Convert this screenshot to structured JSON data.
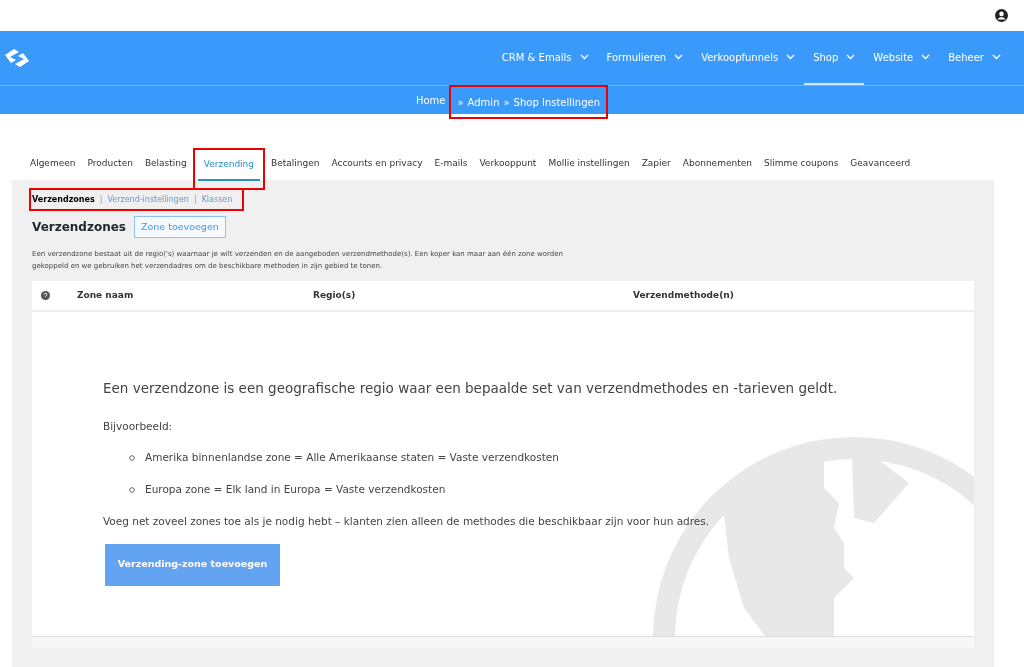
{
  "nav": {
    "items": [
      {
        "label": "CRM & Emails",
        "selected": false
      },
      {
        "label": "Formulieren",
        "selected": false
      },
      {
        "label": "Verkoopfunnels",
        "selected": false
      },
      {
        "label": "Shop",
        "selected": true
      },
      {
        "label": "Website",
        "selected": false
      },
      {
        "label": "Beheer",
        "selected": false
      }
    ]
  },
  "breadcrumb": [
    "Home",
    "Admin",
    "Shop Instellingen"
  ],
  "breadcrumb_separator": "»",
  "tabs": [
    {
      "label": "Algemeen",
      "selected": false
    },
    {
      "label": "Producten",
      "selected": false
    },
    {
      "label": "Belasting",
      "selected": false
    },
    {
      "label": "Verzending",
      "selected": true
    },
    {
      "label": "Betalingen",
      "selected": false
    },
    {
      "label": "Accounts en privacy",
      "selected": false
    },
    {
      "label": "E-mails",
      "selected": false
    },
    {
      "label": "Verkooppunt",
      "selected": false
    },
    {
      "label": "Mollie instellingen",
      "selected": false
    },
    {
      "label": "Zapier",
      "selected": false
    },
    {
      "label": "Abonnementen",
      "selected": false
    },
    {
      "label": "Slimme coupons",
      "selected": false
    },
    {
      "label": "Geavanceerd",
      "selected": false
    }
  ],
  "subnav": {
    "separator": "|",
    "items": [
      {
        "label": "Verzendzones",
        "selected": true
      },
      {
        "label": "Verzend-instellingen",
        "selected": false
      },
      {
        "label": "Klassen",
        "selected": false
      }
    ]
  },
  "section": {
    "title": "Verzendzones",
    "add_button": "Zone toevoegen",
    "description": "Een verzendzone bestaat uit de regio('s) waarnaar je wilt verzenden en de aangeboden verzendmethode(s). Een koper kan maar aan één zone worden gekoppeld en we gebruiken het verzendadres om de beschikbare methoden in zijn gebied te tonen."
  },
  "table": {
    "columns": [
      "Zone naam",
      "Regio(s)",
      "Verzendmethode(n)"
    ]
  },
  "empty_state": {
    "heading": "Een verzendzone is een geografische regio waar een bepaalde set van verzendmethodes en -tarieven geldt.",
    "intro": "Bijvoorbeeld:",
    "examples": [
      "Amerika binnenlandse zone = Alle Amerikaanse staten = Vaste verzendkosten",
      "Europa zone = Elk land in Europa = Vaste verzendkosten"
    ],
    "note": "Voeg net zoveel zones toe als je nodig hebt – klanten zien alleen de methodes die beschikbaar zijn voor hun adres.",
    "button": "Verzending-zone toevoegen"
  }
}
